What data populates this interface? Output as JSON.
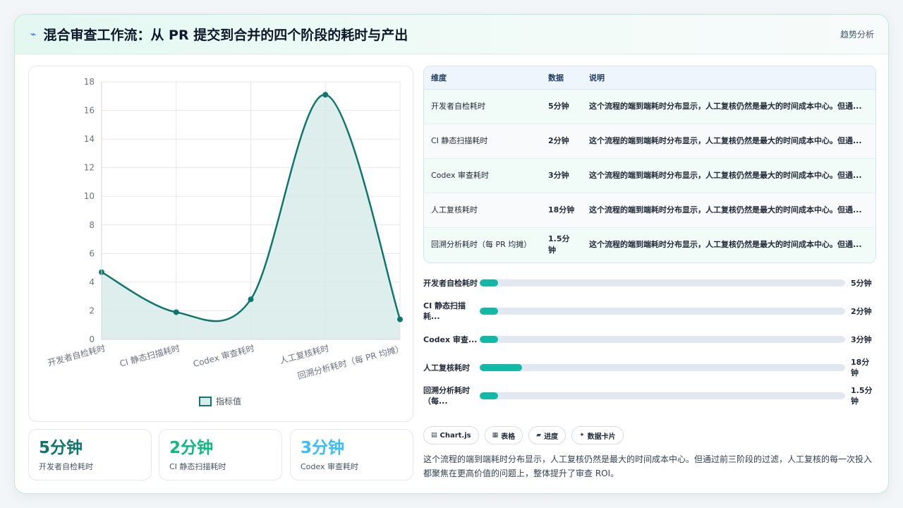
{
  "header": {
    "icon": "lightning-icon",
    "title": "混合审查工作流：从 PR 提交到合并的四个阶段的耗时与产出",
    "link": "趋势分析"
  },
  "chart_data": {
    "type": "area",
    "categories": [
      "开发者自检耗时",
      "CI 静态扫描耗时",
      "Codex 审查耗时",
      "人工复核耗时",
      "回溯分析耗时（每 PR 均摊）"
    ],
    "series": [
      {
        "name": "指标值",
        "values": [
          4.7,
          1.9,
          2.8,
          17.1,
          1.4
        ]
      }
    ],
    "ylim": [
      0,
      18
    ],
    "yticks": [
      "0",
      "2",
      "4",
      "6",
      "8",
      "10",
      "12",
      "14",
      "16",
      "18"
    ],
    "grid": true,
    "legend": "bottom",
    "colors": {
      "line": "#0f766e",
      "fill": "#d7ebe9"
    }
  },
  "kpis": [
    {
      "value": "5分钟",
      "label": "开发者自检耗时",
      "color": "#0f766e"
    },
    {
      "value": "2分钟",
      "label": "CI 静态扫描耗时",
      "color": "#10b981"
    },
    {
      "value": "3分钟",
      "label": "Codex 审查耗时",
      "color": "#38bdf8"
    }
  ],
  "table": {
    "headers": [
      "维度",
      "数据",
      "说明"
    ],
    "rows": [
      [
        "开发者自检耗时",
        "5分钟",
        "这个流程的端到端耗时分布显示，人工复核仍然是最大的时间成本中心。但通..."
      ],
      [
        "CI 静态扫描耗时",
        "2分钟",
        "这个流程的端到端耗时分布显示，人工复核仍然是最大的时间成本中心。但通..."
      ],
      [
        "Codex 审查耗时",
        "3分钟",
        "这个流程的端到端耗时分布显示，人工复核仍然是最大的时间成本中心。但通..."
      ],
      [
        "人工复核耗时",
        "18分钟",
        "这个流程的端到端耗时分布显示，人工复核仍然是最大的时间成本中心。但通..."
      ],
      [
        "回溯分析耗时（每 PR 均摊）",
        "1.5分钟",
        "这个流程的端到端耗时分布显示，人工复核仍然是最大的时间成本中心。但通..."
      ]
    ]
  },
  "progress": [
    {
      "label": "开发者自检耗时",
      "value": "5分钟",
      "fraction": 0.05
    },
    {
      "label": "CI 静态扫描耗...",
      "value": "2分钟",
      "fraction": 0.05
    },
    {
      "label": "Codex 审查...",
      "value": "3分钟",
      "fraction": 0.05
    },
    {
      "label": "人工复核耗时",
      "value": "18分钟",
      "fraction": 0.115
    },
    {
      "label": "回溯分析耗时（每...",
      "value": "1.5分钟",
      "fraction": 0.05
    }
  ],
  "tags": [
    {
      "icon": "chart-icon",
      "glyph": "▤",
      "label": "Chart.js"
    },
    {
      "icon": "table-icon",
      "glyph": "▦",
      "label": "表格"
    },
    {
      "icon": "progress-icon",
      "glyph": "▰",
      "label": "进度"
    },
    {
      "icon": "card-icon",
      "glyph": "✦",
      "label": "数据卡片"
    }
  ],
  "summary": "这个流程的端到端耗时分布显示，人工复核仍然是最大的时间成本中心。但通过前三阶段的过滤，人工复核的每一次投入都聚焦在更高价值的问题上，整体提升了审查 ROI。"
}
